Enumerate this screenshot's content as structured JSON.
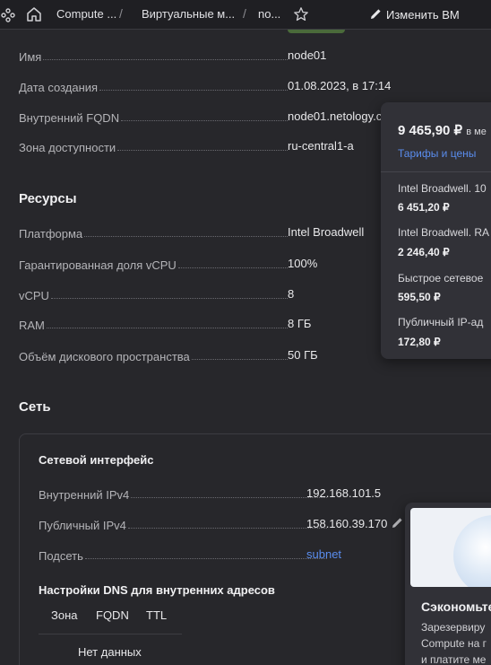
{
  "header": {
    "crumbs": [
      "Compute ...",
      "Виртуальные м...",
      "no..."
    ],
    "edit_label": "Изменить ВМ"
  },
  "general": {
    "name_label": "Имя",
    "name_value": "node01",
    "created_label": "Дата создания",
    "created_value": "01.08.2023, в 17:14",
    "fqdn_label": "Внутренний FQDN",
    "fqdn_value": "node01.netology.c",
    "zone_label": "Зона доступности",
    "zone_value": "ru-central1-a"
  },
  "resources": {
    "title": "Ресурсы",
    "platform_label": "Платформа",
    "platform_value": "Intel Broadwell",
    "fraction_label": "Гарантированная доля vCPU",
    "fraction_value": "100%",
    "vcpu_label": "vCPU",
    "vcpu_value": "8",
    "ram_label": "RAM",
    "ram_value": "8 ГБ",
    "disk_label": "Объём дискового пространства",
    "disk_value": "50 ГБ"
  },
  "network": {
    "title": "Сеть",
    "interface_title": "Сетевой интерфейс",
    "internal_ip_label": "Внутренний IPv4",
    "internal_ip_value": "192.168.101.5",
    "public_ip_label": "Публичный IPv4",
    "public_ip_value": "158.160.39.170",
    "subnet_label": "Подсеть",
    "subnet_value": "subnet",
    "dns_title": "Настройки DNS для внутренних адресов",
    "dns_columns": [
      "Зона",
      "FQDN",
      "TTL"
    ],
    "dns_empty": "Нет данных"
  },
  "price_popup": {
    "total": "9 465,90 ₽",
    "period": "в ме",
    "tariff_link": "Тарифы и цены",
    "items": [
      {
        "name": "Intel Broadwell. 10",
        "price": "6 451,20 ₽"
      },
      {
        "name": "Intel Broadwell. RA",
        "price": "2 246,40 ₽"
      },
      {
        "name": "Быстрое сетевое",
        "price": "595,50 ₽"
      },
      {
        "name": "Публичный IP-ад",
        "price": "172,80 ₽"
      }
    ]
  },
  "promo": {
    "title": "Сэкономьте",
    "lines": [
      "Зарезервиру",
      "Compute на г",
      "и платите ме"
    ]
  },
  "colors": {
    "background": "#27272b",
    "link": "#5a8dee",
    "popup": "#313137"
  }
}
